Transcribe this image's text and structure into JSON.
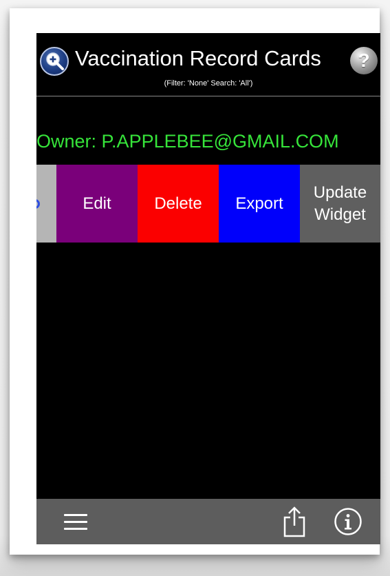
{
  "header": {
    "title": "Vaccination Record Cards",
    "filter_line": "(Filter: 'None' Search: 'All')",
    "help_glyph": "?"
  },
  "owner_line": "Owner: P.APPLEBEE@GMAIL.COM",
  "actions": {
    "edit": "Edit",
    "delete": "Delete",
    "export": "Export",
    "update_line1": "Update",
    "update_line2": "Widget"
  },
  "colors": {
    "owner_text": "#36e43a",
    "edit_bg": "#7a007a",
    "delete_bg": "#fb0000",
    "export_bg": "#0000fb",
    "update_bg": "#5f5f5f",
    "toolbar_bg": "#5d5d5d"
  },
  "icons": {
    "search": "zoom-in-magnifier-icon",
    "help": "question-mark-icon",
    "menu": "hamburger-menu-icon",
    "share": "share-icon",
    "info": "info-icon"
  }
}
